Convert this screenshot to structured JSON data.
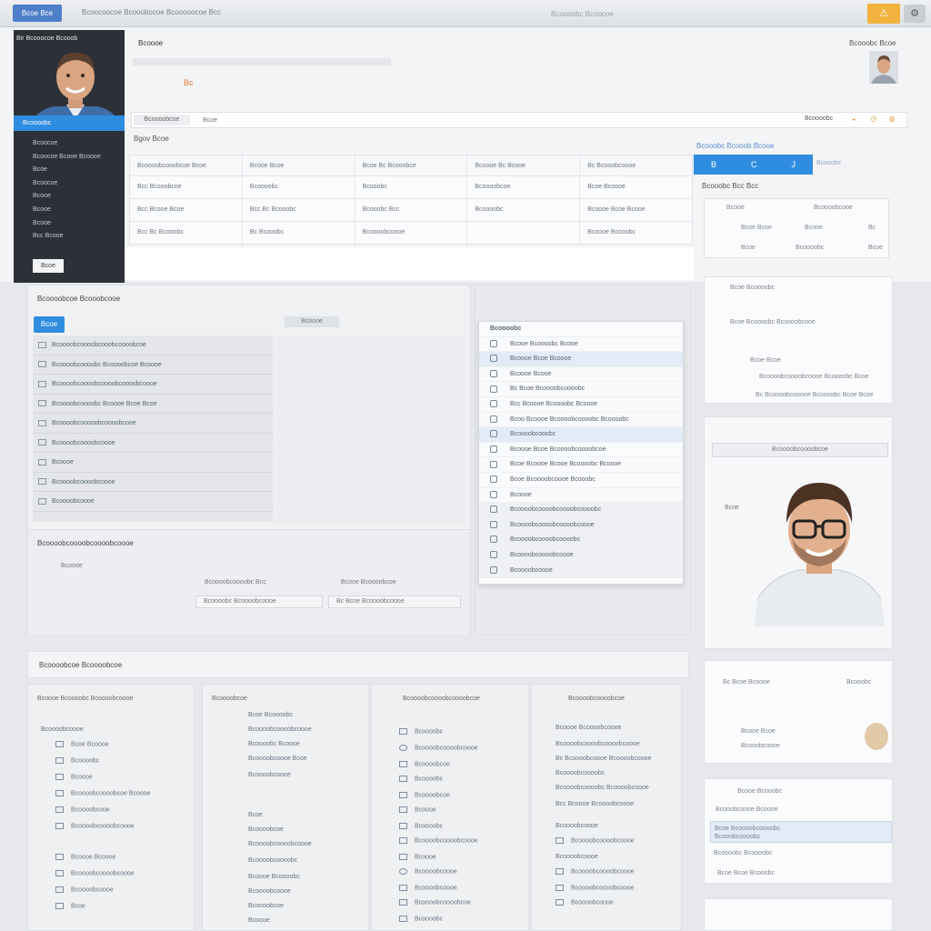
{
  "topbar": {
    "logo": "Bcoe Bce",
    "title": "Bcoocoocoe Bcooobocoe Bcooooocoe Bcc",
    "center": "Bcoooobc Bcoocoe",
    "warn_icon": "warning-icon",
    "user_icon": "user-cart-icon"
  },
  "profile": {
    "name": "Bir Bcooocoe Bcooob",
    "tab": "Bcoooobc",
    "items": [
      "Bcoocoe",
      "Bcoocoe Bcooe Bcoooe",
      "Bcoe",
      "Bcoocoe",
      "Bcooe",
      "Bcooe",
      "Bcooe",
      "Bcc Bcooe"
    ],
    "button": "Bcoe"
  },
  "header": {
    "label": "Bcoooe",
    "orange": "Bc",
    "right": "Bcooobc Bcoe"
  },
  "search": {
    "button": "Bcoooobcoe",
    "placeholder": "Bcoe",
    "right": "Bcoooobc"
  },
  "section_label": "Bgov Bcoe",
  "table": {
    "headers": [
      "Bcoooobcooobcoe Bcoe",
      "Bcooe Bcoe",
      "Bcoe Bc Bcooobce",
      "Bcoooe  Bc Bcooe",
      "Bc Bcooobcoooe"
    ],
    "rows": [
      [
        "Bcc Bcooobcoe",
        "Bcoooobc",
        "Bcooobc",
        "Bcoooobcoe",
        "Bcoe   Bcoooe"
      ],
      [
        "Bcc   Bcooe Bcoe",
        "Bcc   Bc Bcooobc",
        "Bcooobc  Bcc",
        "Bcoooobc",
        "Bcoooe  Bcoe  Bcooe"
      ],
      [
        "Bcc   Bc Bcooobc",
        "Bc  Bcooobc",
        "Bcoooobcoooe",
        "",
        "Bcoooe  Bcooobc"
      ]
    ]
  },
  "right_tabs": {
    "label": "Bcooobc Bcooob Bcooe",
    "tabs": [
      "B",
      "C",
      "J"
    ],
    "sub": "Bcooobc",
    "title": "Bcooobc Bcc Bcc"
  },
  "right_cards": {
    "card1": [
      "Bcooe",
      "Bcoooobcooe",
      "Bcoe Bcoe",
      "Bcooe",
      "Bc",
      "Bcoe",
      "Bcoooobc",
      "Bcoe"
    ],
    "card2": [
      "Bcoe Bcoooobc",
      "Bcoe Bcoooobc Bcoooobcooe",
      "Bcoe Bcoe",
      "Bcoooobcoooobcoooe Bcoooobc Bcoe",
      "Bc Bcoooobcooooe Bcoooobc Bcoe Bcoe"
    ],
    "card4": [
      "Bc Bcoe Bcoooe",
      "Bcooobc",
      "Bcooe Bcoe",
      "Bcooobcoooe"
    ],
    "card5": [
      "Bcooe Bcooobc",
      "Bcooobcoooe Bcoooe",
      "Bcoe Bcoooobcoooobc",
      "Bcooobcoooobc",
      "Bcoooobc Bcoooobc",
      "Bcoe  Bcoe  Bcooobc"
    ]
  },
  "middle": {
    "title": "Bcoooobcoe Bcooobcooe",
    "button": "Bcoe",
    "search": "Bcoooe",
    "list": [
      "Bcoooobcoooobcooobcoooobcoe",
      "Bcoooobcoooobc Bcoooobcoe Bcoooe",
      "Bcoooobcoooobcoooobcoooobcoooe",
      "Bcoooobcoooobc Bcoooe Bcoe Bcoe",
      "Bcoooobcooooobcoooobcooe",
      "Bcoooobcoooobcoooe",
      "Bcoooe",
      "Bcoooobcoooobcoooe",
      "Bcoooobcoooe",
      "Bcoooobcoooe"
    ],
    "sub_title": "Bcoooobcoooobcoooobcoooe",
    "sub_items": [
      "Bcoooe",
      "Bcoooobcoooobc Bcc",
      "Bcooe Bcoooobcoe",
      "Bcoooobc Bcoooobcoooe",
      "Bc Bcoe Bcoooobcoooe"
    ]
  },
  "dropdown": {
    "header": "Bcoooobc",
    "items": [
      "Bcooe Bcoooobc Bcooe",
      "Bcoooe Bcoe Bcoooe",
      "Bcoooe Bcooe",
      "Bc Bcoe Bcoooobcoooobc",
      "Bcc Bcoooe Bcoooobc Bcoooe",
      "Bcoo Bcoooe Bcoooobcoooobc Bcoooobc",
      "Bcoooobcooobc",
      "Bcoooe Bcoe Bcoooobcoooobcoe",
      "Bcoe Bcoooe Bcooe Bcoooobc Bcoooe",
      "Bcoe Bcoooobcoooe Bcooobc",
      "Bcoooe",
      "Bcoooobcoooobcoooobcoooobc",
      "Bcoooobcoooobcoooobcoooe",
      "Bcoooobcoooobcoooobc",
      "Bcoooobcoooobcoooe",
      "Bcoooobcoooe"
    ]
  },
  "bottom": {
    "title": "Bcoooobcoe Bcoooobcoe",
    "col1": {
      "title": "Bcoooe Bcoooobc Bcoooobcoooe",
      "items": [
        "Bcoooobcoooe",
        "Bcoe Bcoooe",
        "Bcoooobc",
        "Bcoooe",
        "Bcoooobcoooobcoe Bcoooe",
        "Bcoooobcooe",
        "Bcoooobcoooobcoooe",
        "Bcoooe Bcoooe",
        "Bcoooobcoooobcoooe",
        "Bcoooobcoooe",
        "Bcoe"
      ]
    },
    "col2": {
      "title": "Bcoooobcoe",
      "items": [
        "Bcoe Bcoooobc",
        "Bcoooobcoooobcoooe",
        "Bcoooobc Bcoooe",
        "Bcoooobcoooe Bcoe",
        "Bcoooobcoooe",
        "Bcoe",
        "Bcoooobcoe",
        "Bcoooobcoooobcoooe",
        "Bcoooobcoooobc",
        "Bcoooe Bcoooobc",
        "Bcoooobcoooe",
        "Bcoooobcoe",
        "Bcoooe"
      ]
    },
    "col3": {
      "title": "Bcoooobcoooobcoooobcoe",
      "items": [
        "Bcoooobc",
        "Bcoooobcoooobcoooe",
        "Bcoooobcoe",
        "Bcoooobc",
        "Bcoooobcoe",
        "Bcoooe",
        "Bcoooobc",
        "Bcoooobcoooobcoooe",
        "Bcoooe",
        "Bcoooobcoooe",
        "Bcoooobcoooe",
        "Bcoooobcoooobcoe",
        "Bcoooobc"
      ]
    },
    "col4": {
      "title": "Bcoooobcoooobcoe",
      "items": [
        "Bcoooe Bcoooobcoooe",
        "Bcoooobcoooobcoooobcoooe",
        "Bc Bcoooobcoooe Bcoooobcoooe",
        "Bcoooobcoooobc",
        "Bcoooobcoooobc Bcoooobcoooe",
        "Bcc Bcoooe Bcoooobcoooe",
        "Bcoooobcoooe",
        "Bcoooobcoooobcoooe",
        "Bcoooobcoooe",
        "Bcoooobcoooobcoooe",
        "Bcoooobcoooobcoooe",
        "Bcoooobcoooe"
      ]
    }
  },
  "photo_card": {
    "strip": "Bcoooobcoooobcoe",
    "label": "Bcoe"
  },
  "colors": {
    "accent": "#2f8de0",
    "warn": "#f2b23e",
    "sidebar": "#2d3137"
  }
}
